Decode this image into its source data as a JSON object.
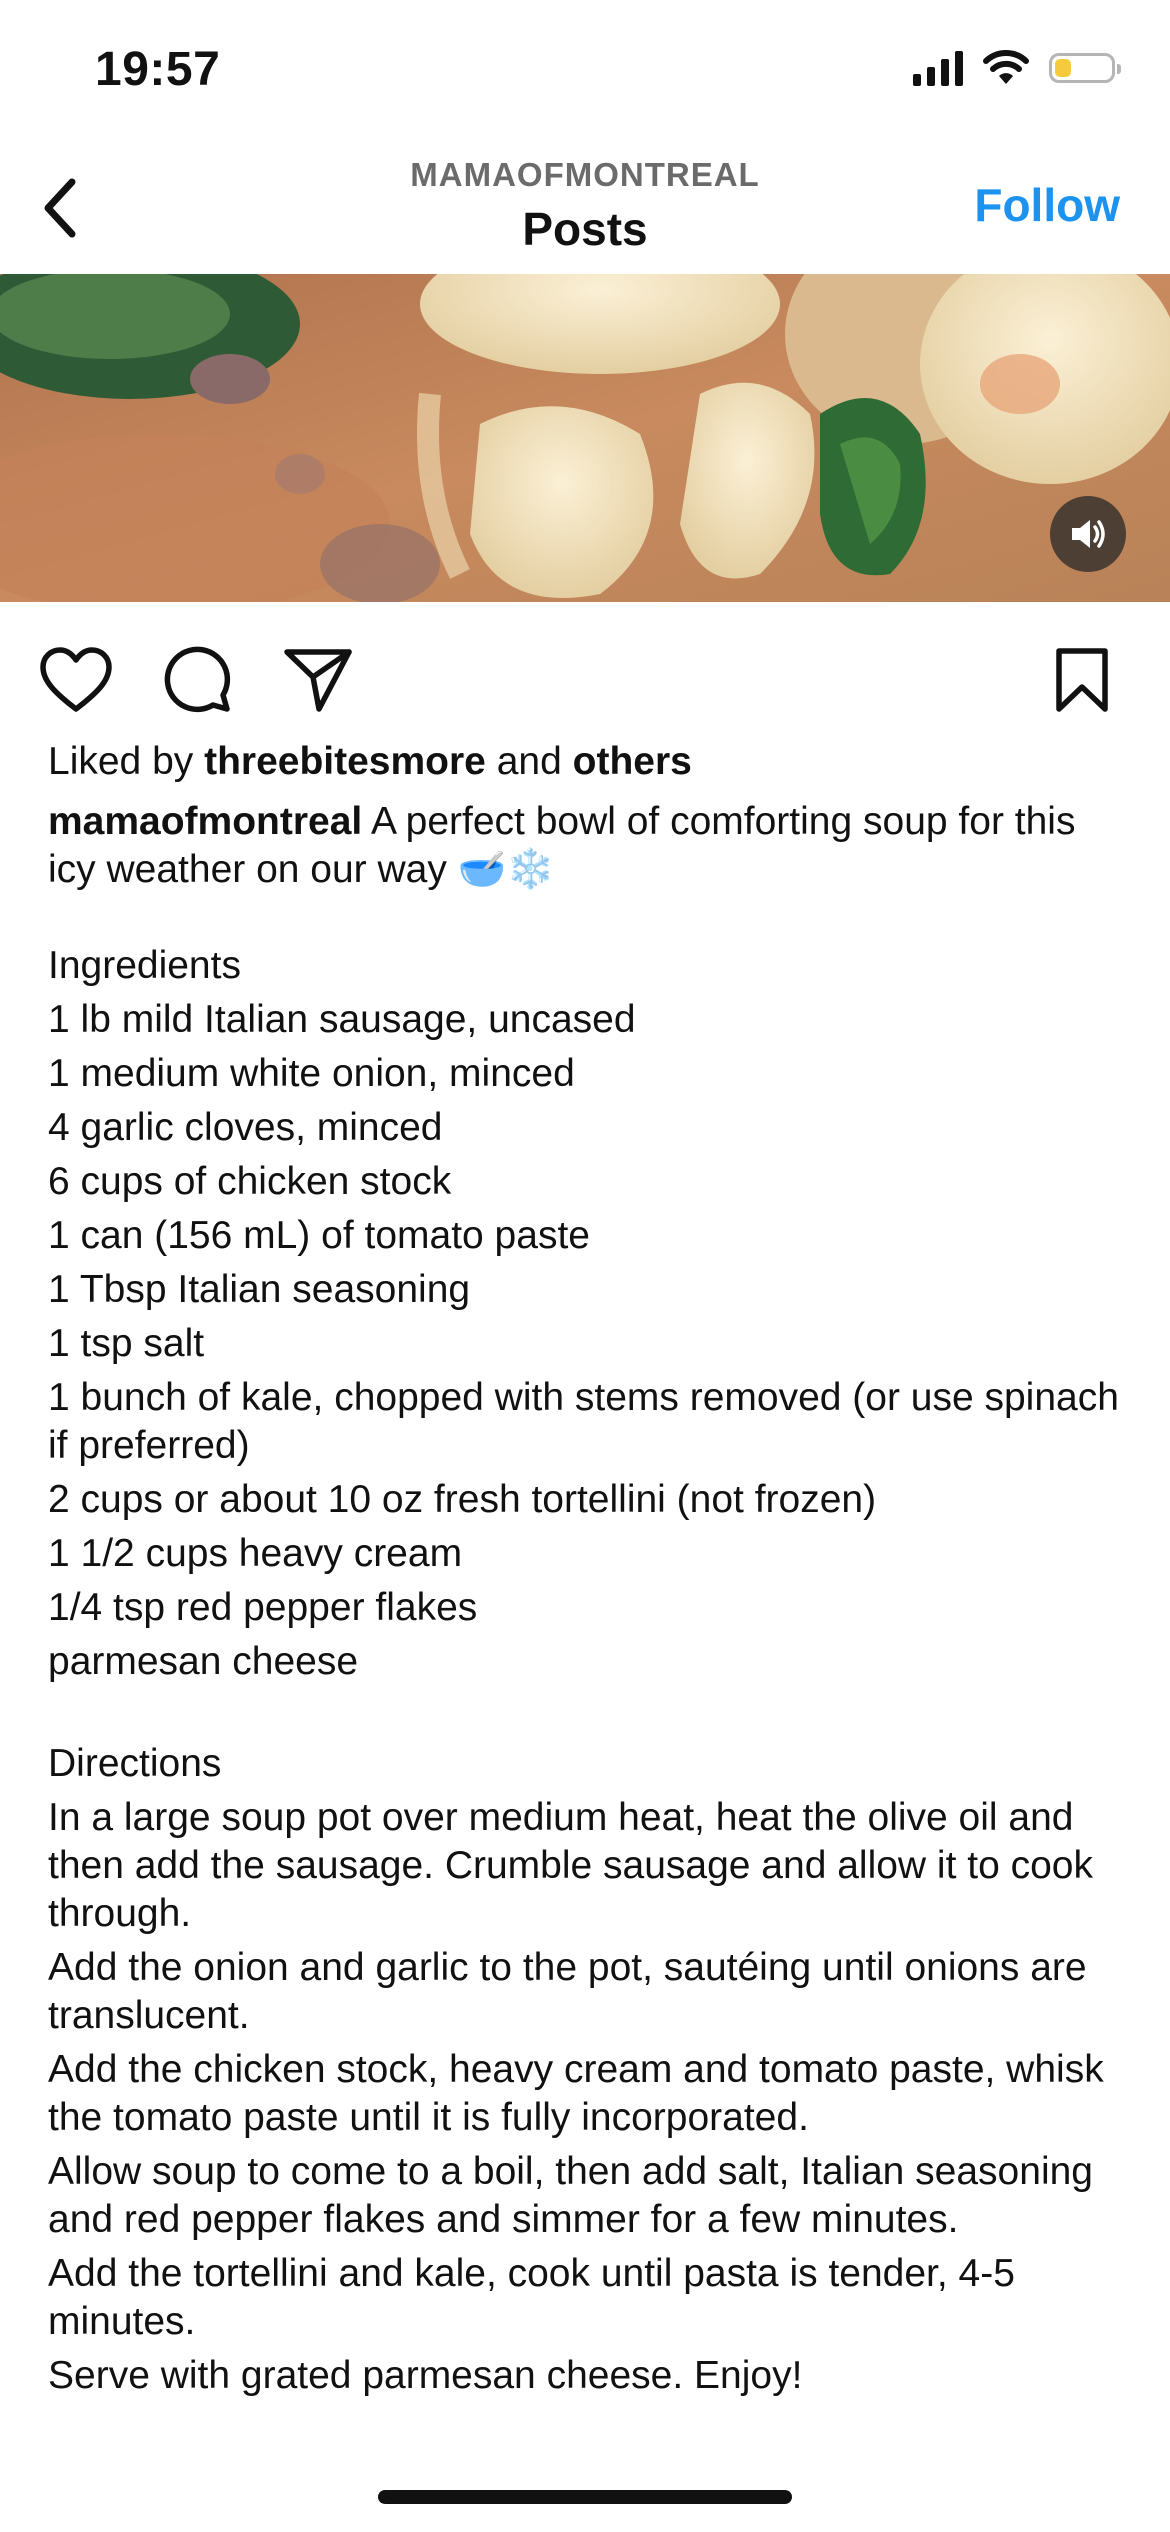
{
  "status_bar": {
    "time": "19:57",
    "battery_level": 0.3,
    "icons": [
      "signal-icon",
      "wifi-icon",
      "battery-icon"
    ]
  },
  "header": {
    "username": "MAMAOFMONTREAL",
    "title": "Posts",
    "follow_label": "Follow",
    "back_icon": "back-chevron-icon"
  },
  "media": {
    "mute_icon": "speaker-icon"
  },
  "actions": {
    "icons": [
      "heart-icon",
      "comment-icon",
      "share-icon",
      "bookmark-icon"
    ]
  },
  "likes": {
    "prefix": "Liked by",
    "user": "threebitesmore",
    "connector": "and",
    "others": "others"
  },
  "caption": {
    "username": "mamaofmontreal",
    "intro": "A perfect bowl of comforting soup for this icy weather on our way 🥣❄️",
    "ingredients_heading": "Ingredients",
    "ingredients": [
      "1 lb mild Italian sausage, uncased",
      "1 medium white onion, minced",
      "4 garlic cloves, minced",
      "6 cups of chicken stock",
      "1 can (156 mL) of tomato paste",
      "1 Tbsp Italian seasoning",
      "1 tsp salt",
      "1 bunch of kale, chopped with stems removed (or use spinach if preferred)",
      "2 cups or about 10 oz fresh tortellini (not frozen)",
      "1 1/2 cups heavy cream",
      "1/4 tsp red pepper flakes",
      "parmesan cheese"
    ],
    "directions_heading": "Directions",
    "directions": [
      "In a large soup pot over medium heat, heat the olive oil and then add the sausage. Crumble sausage and allow it to cook through.",
      "Add the onion and garlic to the pot, sautéing until onions are translucent.",
      "Add the chicken stock, heavy cream and tomato paste, whisk the tomato paste until it is fully incorporated.",
      "Allow soup to come to a boil, then add salt, Italian seasoning and red pepper flakes and simmer for a few minutes.",
      "Add the tortellini and kale, cook until pasta is tender, 4-5 minutes.",
      "Serve with grated parmesan cheese. Enjoy!"
    ]
  },
  "colors": {
    "accent": "#1d93f0",
    "text": "#111111",
    "muted": "#6b6b6b",
    "battery": "#f5ca3b"
  }
}
